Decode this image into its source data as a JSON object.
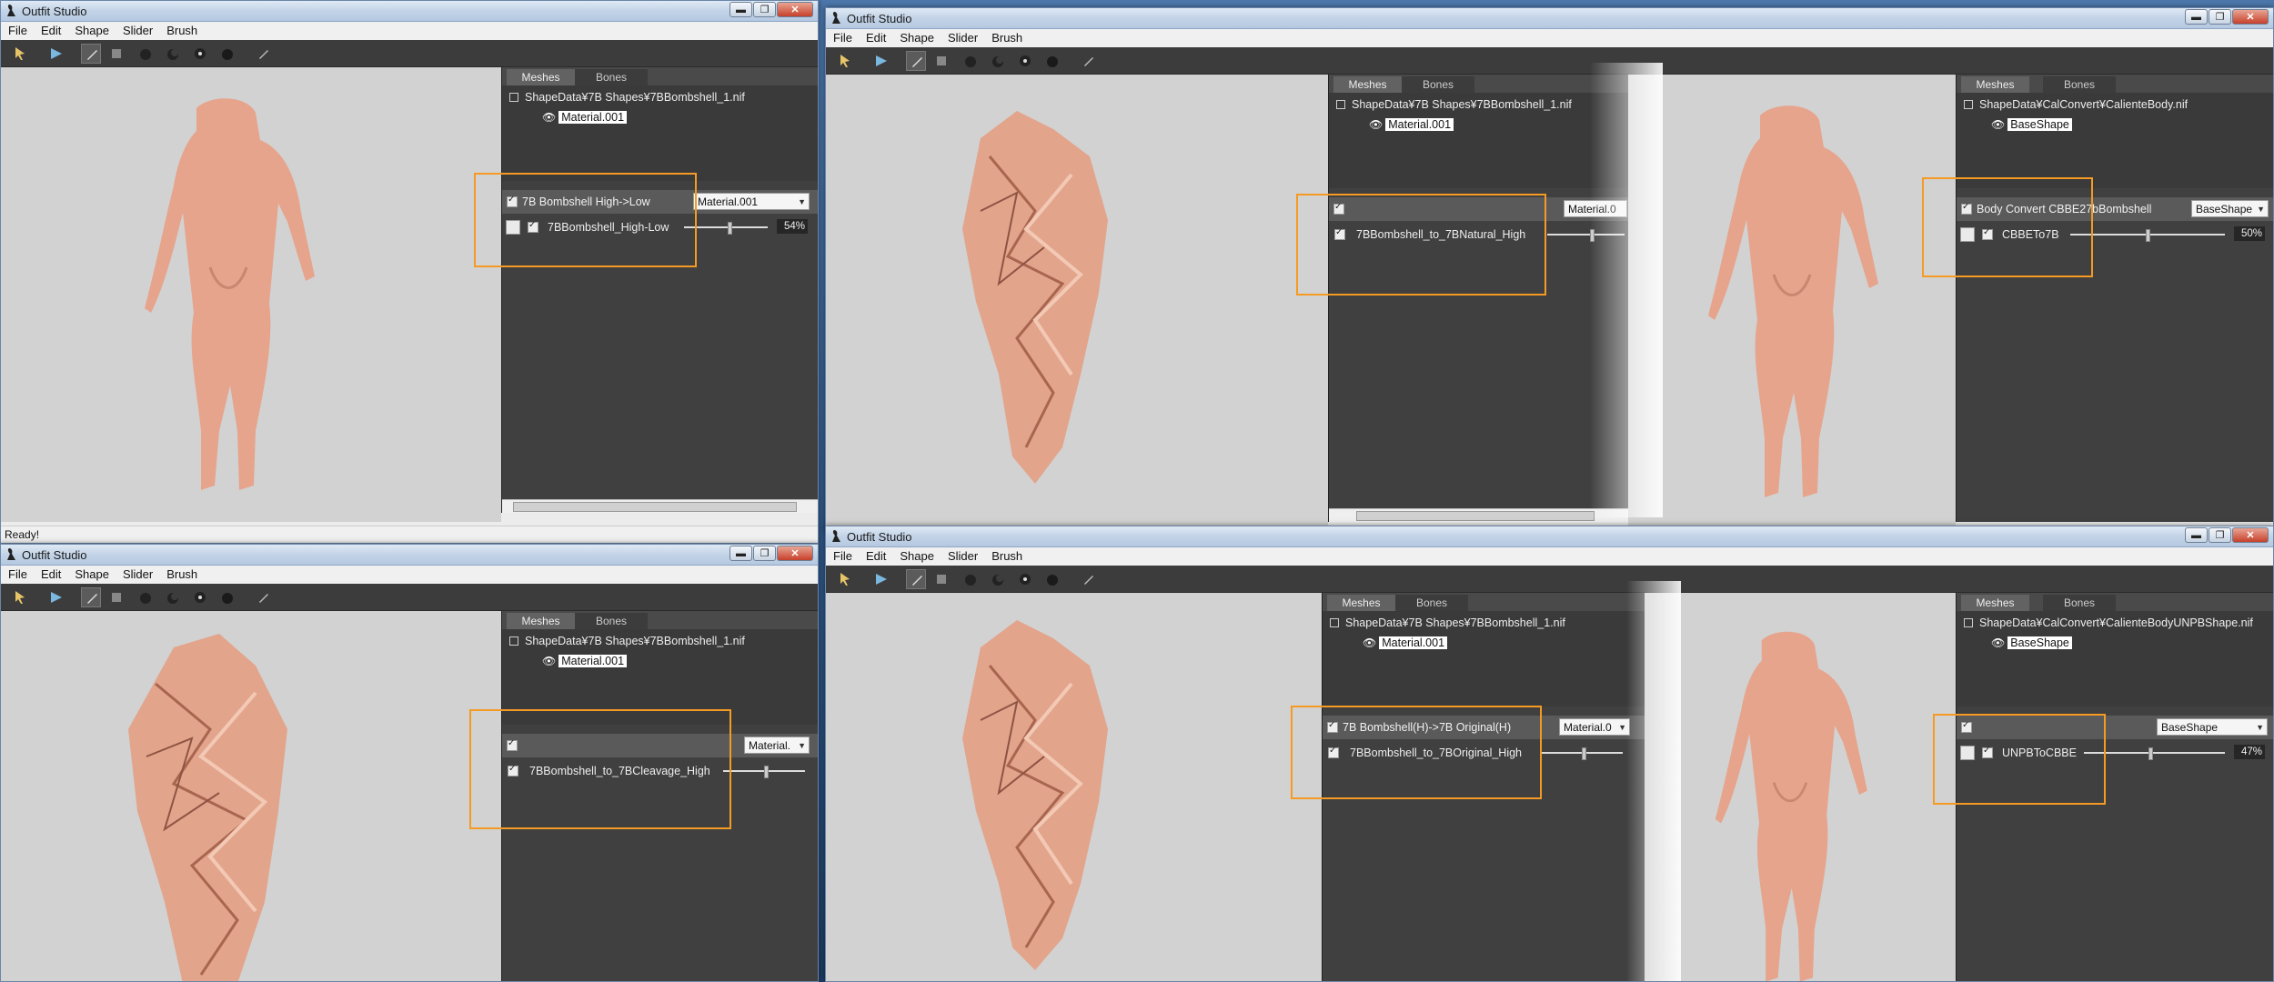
{
  "app": {
    "title": "Outfit Studio",
    "menu": [
      "File",
      "Edit",
      "Shape",
      "Slider",
      "Brush"
    ],
    "tabs": {
      "meshes": "Meshes",
      "bones": "Bones"
    },
    "window_controls": {
      "minimize": "▬",
      "maximize": "❐",
      "close": "✕"
    }
  },
  "panels": [
    {
      "tree_root": "ShapeData¥7B Shapes¥7BBombshell_1.nif",
      "tree_child": "Material.001",
      "set_name": "7B Bombshell High->Low",
      "dropdown": "Material.001",
      "slider_name": "7BBombshell_High-Low",
      "percent": "54%",
      "value": 0.54,
      "status": "Ready!"
    },
    {
      "tree_root": "ShapeData¥7B Shapes¥7BBombshell_1.nif",
      "tree_child": "Material.001",
      "set_name": "",
      "dropdown": "Material.0",
      "slider_name": "7BBombshell_to_7BNatural_High",
      "percent": "",
      "value": 0.58
    },
    {
      "tree_root": "ShapeData¥CalConvert¥CalienteBody.nif",
      "tree_child": "BaseShape",
      "set_name": "Body Convert CBBE27bBombshell",
      "dropdown": "BaseShape",
      "slider_name": "CBBETo7B",
      "percent": "50%",
      "value": 0.5
    },
    {
      "tree_root": "ShapeData¥7B Shapes¥7BBombshell_1.nif",
      "tree_child": "Material.001",
      "set_name": "",
      "dropdown": "Material.",
      "slider_name": "7BBombshell_to_7BCleavage_High",
      "percent": "",
      "value": 0.52
    },
    {
      "tree_root": "ShapeData¥7B Shapes¥7BBombshell_1.nif",
      "tree_child": "Material.001",
      "set_name": "7B Bombshell(H)->7B Original(H)",
      "dropdown": "Material.0",
      "slider_name": "7BBombshell_to_7BOriginal_High",
      "percent": "",
      "value": 0.52
    },
    {
      "tree_root": "ShapeData¥CalConvert¥CalienteBodyUNPBShape.nif",
      "tree_child": "BaseShape",
      "set_name": "",
      "dropdown": "BaseShape",
      "slider_name": "UNPBToCBBE",
      "percent": "47%",
      "value": 0.47
    }
  ],
  "colors": {
    "highlight": "#f59a23",
    "skin": "#e6a48c",
    "panel": "#3e3e3e",
    "viewport": "#d2d2d2"
  },
  "icons": [
    "select-icon",
    "transform-icon",
    "brush-icon",
    "inflate-icon",
    "deflate-icon",
    "move-icon",
    "smooth-icon",
    "weight-icon"
  ]
}
